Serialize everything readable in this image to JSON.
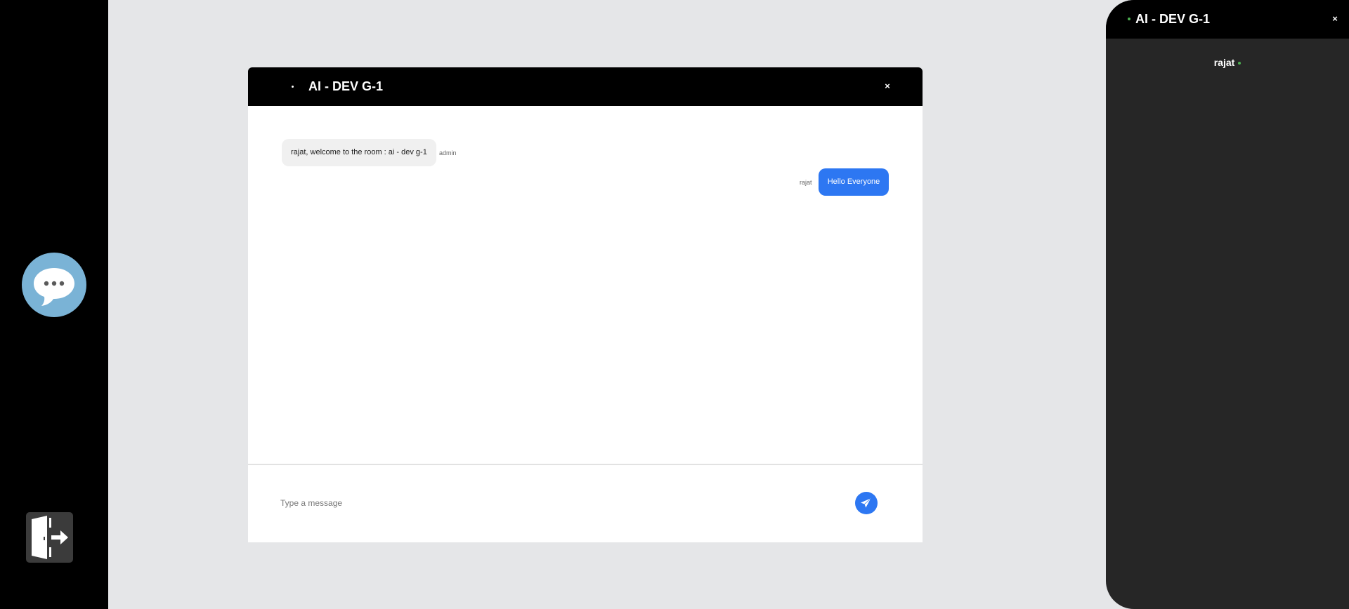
{
  "sidebar": {
    "chat_icon": "chat-bubble-ellipsis-icon",
    "exit_icon": "exit-door-icon"
  },
  "chat": {
    "title": "AI - DEV G-1",
    "close_label": "×",
    "messages": [
      {
        "sender": "admin",
        "text": "rajat, welcome to the room : ai - dev g-1",
        "direction": "incoming"
      },
      {
        "sender": "rajat",
        "text": "Hello Everyone",
        "direction": "outgoing"
      }
    ],
    "input": {
      "placeholder": "Type a message",
      "value": ""
    },
    "send_icon": "paper-plane-icon"
  },
  "room_panel": {
    "title": "AI - DEV G-1",
    "close_label": "×",
    "users": [
      {
        "name": "rajat",
        "status": "online"
      }
    ]
  },
  "colors": {
    "accent_blue": "#2d77f2",
    "online_green": "#4caf50",
    "chat_button": "#7ab3d6",
    "panel_dark": "#262626"
  }
}
